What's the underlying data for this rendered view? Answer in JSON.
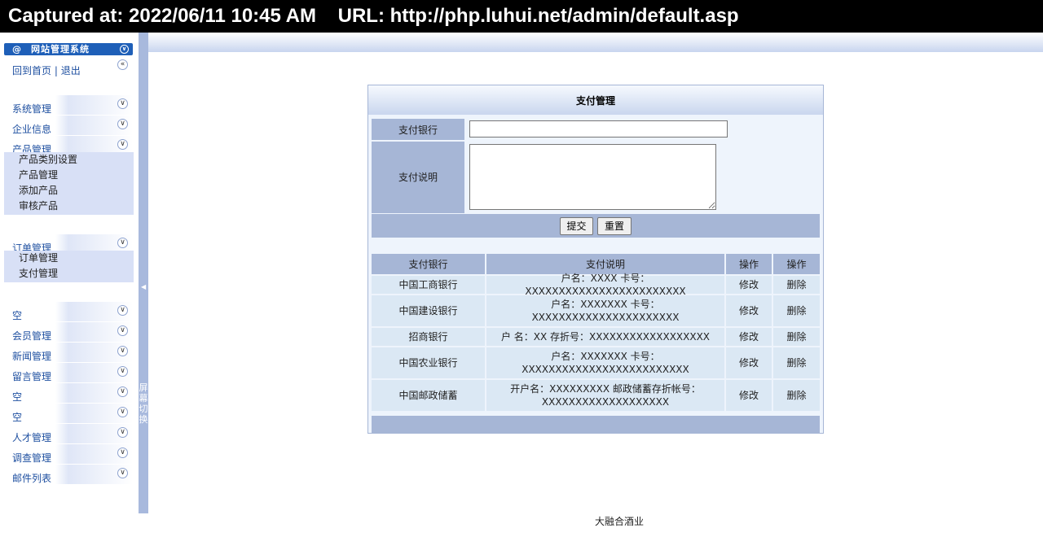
{
  "capture": {
    "captured_at": "Captured at: 2022/06/11 10:45 AM",
    "url": "URL: http://php.luhui.net/admin/default.asp"
  },
  "sidebar": {
    "system_title": "网站管理系统",
    "home_link": "回到首页",
    "separator": "|",
    "logout_link": "退出",
    "sections": [
      {
        "label": "系统管理"
      },
      {
        "label": "企业信息"
      },
      {
        "label": "产品管理",
        "sub": [
          "产品类别设置",
          "产品管理",
          "添加产品",
          "审核产品"
        ]
      },
      {
        "label": "订单管理",
        "sub": [
          "订单管理",
          "支付管理"
        ]
      },
      {
        "label": "空"
      },
      {
        "label": "会员管理"
      },
      {
        "label": "新闻管理"
      },
      {
        "label": "留言管理"
      },
      {
        "label": "空"
      },
      {
        "label": "空"
      },
      {
        "label": "人才管理"
      },
      {
        "label": "调查管理"
      },
      {
        "label": "邮件列表"
      }
    ]
  },
  "divider": {
    "text": "屏幕切换"
  },
  "panel": {
    "title": "支付管理",
    "form": {
      "bank_label": "支付银行",
      "bank_value": "",
      "desc_label": "支付说明",
      "desc_value": "",
      "submit": "提交",
      "reset": "重置"
    },
    "table": {
      "headers": [
        "支付银行",
        "支付说明",
        "操作",
        "操作"
      ],
      "rows": [
        {
          "bank": "中国工商银行",
          "desc1": "户名：XXXX 卡号：XXXXXXXXXXXXXXXXXXXXXXXX",
          "desc2": "",
          "edit": "修改",
          "del": "删除"
        },
        {
          "bank": "中国建设银行",
          "desc1": "户名：XXXXXXX 卡号：",
          "desc2": "XXXXXXXXXXXXXXXXXXXXXX",
          "edit": "修改",
          "del": "删除"
        },
        {
          "bank": "招商银行",
          "desc1": "户 名：XX 存折号：XXXXXXXXXXXXXXXXXX",
          "desc2": "",
          "edit": "修改",
          "del": "删除"
        },
        {
          "bank": "中国农业银行",
          "desc1": "户名：XXXXXXX 卡号：",
          "desc2": "XXXXXXXXXXXXXXXXXXXXXXXXX",
          "edit": "修改",
          "del": "删除"
        },
        {
          "bank": "中国邮政储蓄",
          "desc1": "开户名：XXXXXXXXX 邮政储蓄存折帐号：",
          "desc2": "XXXXXXXXXXXXXXXXXXX",
          "edit": "修改",
          "del": "删除"
        }
      ]
    }
  },
  "footer": {
    "text": "大融合酒业"
  }
}
